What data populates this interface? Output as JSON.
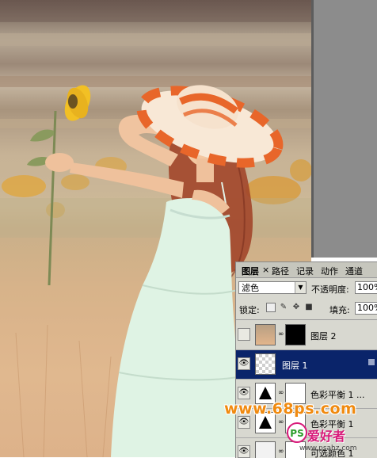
{
  "layers_panel": {
    "tabs": [
      "图层",
      "路径",
      "记录",
      "动作",
      "通道"
    ],
    "tab_close": "×",
    "blend_mode": "滤色",
    "opacity_label": "不透明度:",
    "opacity_value": "100%",
    "lock_label": "锁定:",
    "fill_label": "填充:",
    "fill_value": "100%",
    "layers": [
      {
        "name": "图层 2",
        "visible": false,
        "selected": false
      },
      {
        "name": "图层 1",
        "visible": true,
        "selected": true
      },
      {
        "name": "色彩平衡 1 ...",
        "visible": true,
        "selected": false
      },
      {
        "name": "色彩平衡 1",
        "visible": true,
        "selected": false
      },
      {
        "name": "可选颜色 1",
        "visible": true,
        "selected": false
      }
    ]
  },
  "watermarks": {
    "site": "www.68ps.com",
    "brand": "爱好者",
    "brand_prefix": "PS",
    "brand_url": "www.psahz.com"
  },
  "colors": {
    "selection": "#0a246a",
    "panel_bg": "#d8d8d0",
    "watermark_orange": "#f08a10",
    "watermark_pink": "#d81a7a"
  }
}
